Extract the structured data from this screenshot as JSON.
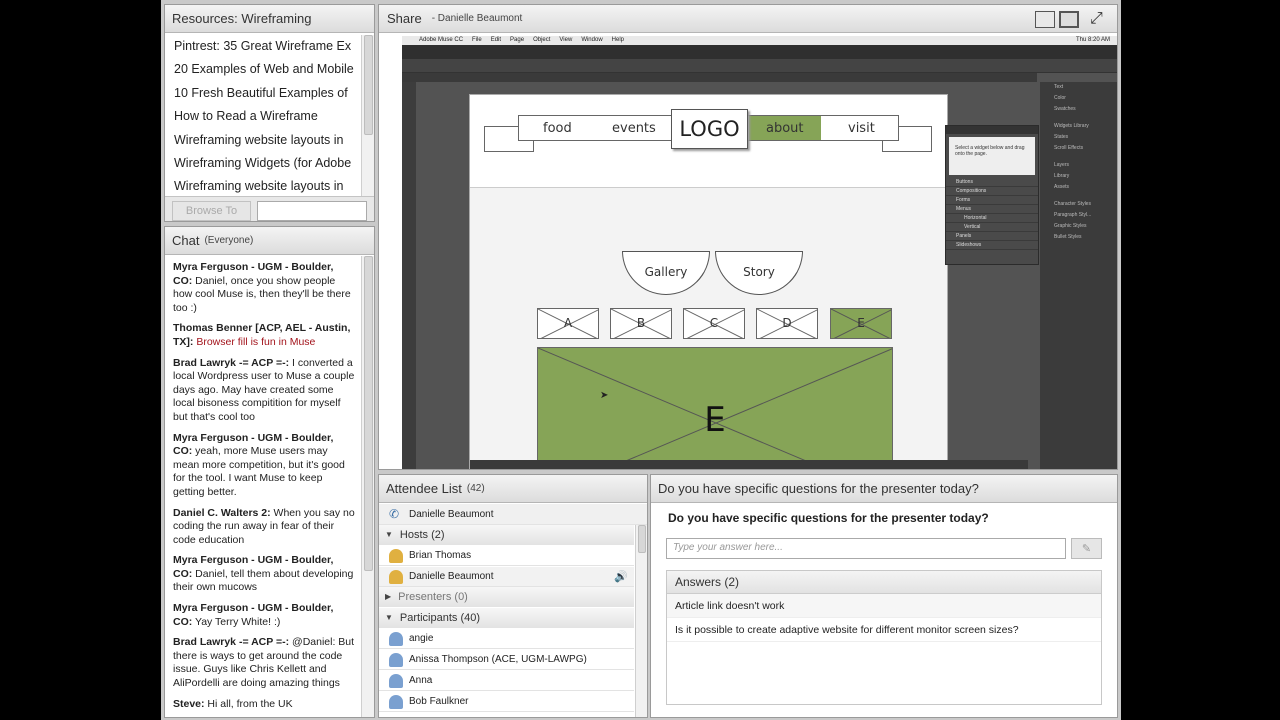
{
  "resources": {
    "title": "Resources: Wireframing",
    "items": [
      "Pintrest: 35 Great Wireframe Ex",
      "20 Examples of Web and Mobile",
      "10 Fresh Beautiful Examples of",
      "How to Read a Wireframe",
      "Wireframing website layouts in",
      "Wireframing Widgets (for Adobe",
      "Wireframing website layouts in"
    ],
    "browse_label": "Browse To",
    "browse_value": ""
  },
  "chat": {
    "title": "Chat",
    "scope": "(Everyone)",
    "messages": [
      {
        "author": "Myra Ferguson - UGM - Boulder, CO:",
        "text": " Daniel, once you show people how cool Muse is, then they'll be there too :)"
      },
      {
        "author": "Thomas Benner [ACP, AEL - Austin, TX]:",
        "text": " Browser fill is fun in Muse"
      },
      {
        "author": "Brad Lawryk -= ACP =-:",
        "text": " I converted a local Wordpress user to Muse a couple days ago. May have created some local bisoness compitition for myself but that's cool too"
      },
      {
        "author": "Myra Ferguson - UGM - Boulder, CO:",
        "text": " yeah, more Muse users may mean more competition, but it's good for the tool. I want Muse to keep getting better."
      },
      {
        "author": "Daniel C. Walters 2:",
        "text": " When you say no coding the run away in fear of their code education"
      },
      {
        "author": "Myra Ferguson - UGM - Boulder, CO:",
        "text": " Daniel, tell them about developing their own mucows"
      },
      {
        "author": "Myra Ferguson - UGM - Boulder, CO:",
        "text": " Yay Terry White! :)"
      },
      {
        "author": "Brad Lawryk -= ACP =-:",
        "text": " @Daniel: But there is ways to get around the code issue. Guys like Chris Kellett and AliPordelli are doing amazing things"
      },
      {
        "author": "Steve:",
        "text": " Hi all, from the UK"
      }
    ]
  },
  "share": {
    "title": "Share",
    "presenter": "- Danielle Beaumont",
    "mac_menu": [
      "Adobe Muse CC",
      "File",
      "Edit",
      "Page",
      "Object",
      "View",
      "Window",
      "Help"
    ],
    "clock": "Thu 8:20 AM",
    "muse_right_panel": [
      "Text",
      "Color",
      "Swatches",
      "Widgets Library",
      "States",
      "Scroll Effects",
      "Layers",
      "Library",
      "Assets",
      "Character Styles",
      "Paragraph Styl...",
      "Graphic Styles",
      "Bullet Styles"
    ],
    "widgets_panel": {
      "help": "Select a widget below and drag onto the page.",
      "items": [
        "Buttons",
        "Compositions",
        "Forms",
        "Menus",
        "Horizontal",
        "Vertical",
        "Panels",
        "Slideshows"
      ]
    },
    "wireframe": {
      "nav": [
        "food",
        "events",
        "about",
        "visit"
      ],
      "logo": "LOGO",
      "tabs": [
        "Gallery",
        "Story"
      ],
      "thumbs": [
        "A",
        "B",
        "C",
        "D",
        "E"
      ],
      "selected": "E"
    }
  },
  "attendees": {
    "title": "Attendee List",
    "count": "(42)",
    "me": "Danielle Beaumont",
    "hosts_label": "Hosts (2)",
    "hosts": [
      "Brian Thomas",
      "Danielle Beaumont"
    ],
    "presenters_label": "Presenters (0)",
    "participants_label": "Participants (40)",
    "participants": [
      "angie",
      "Anissa Thompson (ACE, UGM-LAWPG)",
      "Anna",
      "Bob Faulkner"
    ]
  },
  "questions": {
    "title": "Do you have specific questions for the presenter today?",
    "prompt": "Do you have specific questions for the presenter today?",
    "placeholder": "Type your answer here...",
    "answers_label": "Answers (2)",
    "answers": [
      "Article link doesn't work",
      "Is it possible to create adaptive website for different monitor screen sizes?"
    ]
  }
}
